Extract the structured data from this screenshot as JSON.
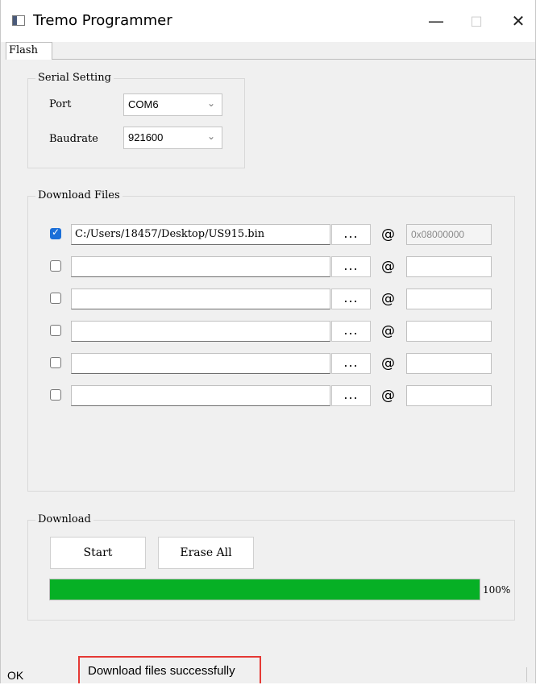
{
  "window": {
    "title": "Tremo Programmer",
    "icon": "app-window-icon"
  },
  "titlebar_buttons": {
    "minimize": "—",
    "maximize": "□",
    "close": "✕"
  },
  "tabs": [
    {
      "label": "Flash",
      "selected": true
    }
  ],
  "serial_setting": {
    "title": "Serial Setting",
    "port_label": "Port",
    "port_value": "COM6",
    "baudrate_label": "Baudrate",
    "baudrate_value": "921600"
  },
  "download_files": {
    "title": "Download Files",
    "browse_label": "...",
    "at_symbol": "@",
    "rows": [
      {
        "checked": true,
        "path": "C:/Users/18457/Desktop/US915.bin",
        "address": "0x08000000"
      },
      {
        "checked": false,
        "path": "",
        "address": ""
      },
      {
        "checked": false,
        "path": "",
        "address": ""
      },
      {
        "checked": false,
        "path": "",
        "address": ""
      },
      {
        "checked": false,
        "path": "",
        "address": ""
      },
      {
        "checked": false,
        "path": "",
        "address": ""
      }
    ]
  },
  "download": {
    "title": "Download",
    "start_label": "Start",
    "erase_label": "Erase All",
    "progress_percent": 100,
    "progress_text": "100%",
    "progress_color": "#06b025"
  },
  "status": {
    "left": "OK",
    "message": "Download files successfully"
  }
}
